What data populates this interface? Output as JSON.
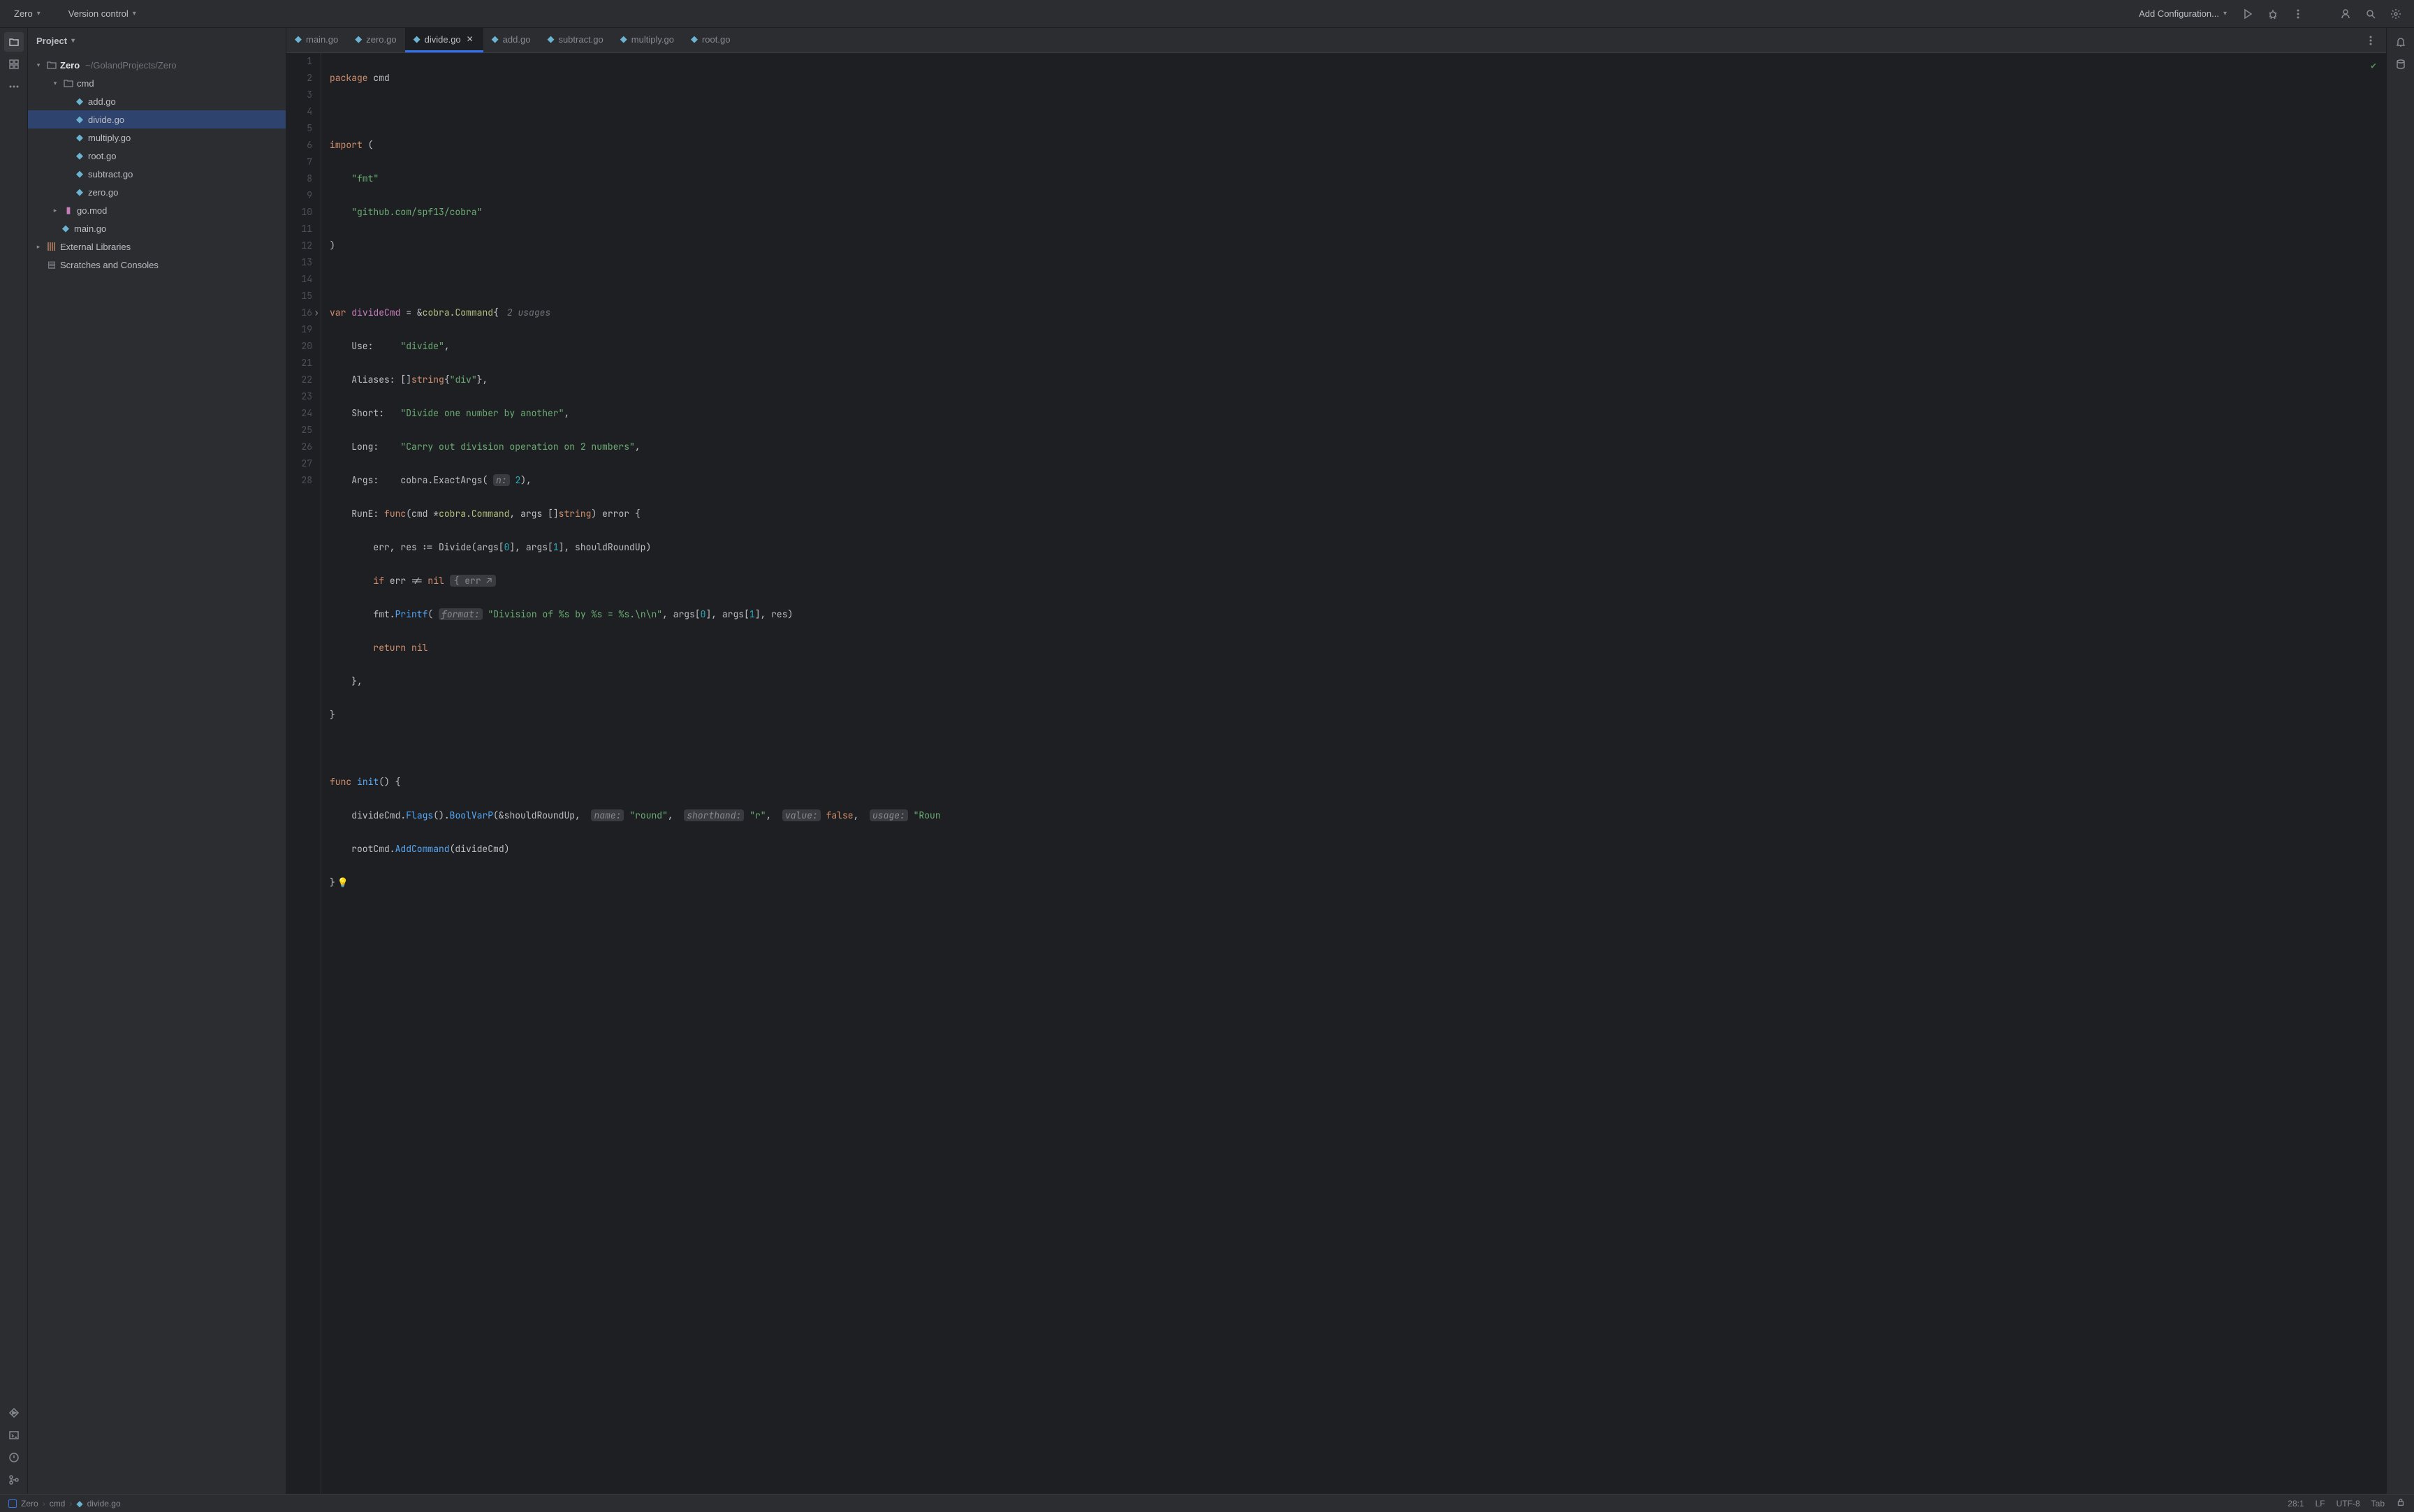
{
  "topbar": {
    "project_name": "Zero",
    "vcs_label": "Version control",
    "run_config": "Add Configuration..."
  },
  "project": {
    "title": "Project",
    "root_name": "Zero",
    "root_path": "~/GolandProjects/Zero",
    "cmd_folder": "cmd",
    "files": {
      "add": "add.go",
      "divide": "divide.go",
      "multiply": "multiply.go",
      "root": "root.go",
      "subtract": "subtract.go",
      "zero": "zero.go"
    },
    "gomod": "go.mod",
    "main": "main.go",
    "external": "External Libraries",
    "scratches": "Scratches and Consoles"
  },
  "tabs": [
    {
      "label": "main.go",
      "active": false
    },
    {
      "label": "zero.go",
      "active": false
    },
    {
      "label": "divide.go",
      "active": true
    },
    {
      "label": "add.go",
      "active": false
    },
    {
      "label": "subtract.go",
      "active": false
    },
    {
      "label": "multiply.go",
      "active": false
    },
    {
      "label": "root.go",
      "active": false
    }
  ],
  "code": {
    "lines": 28,
    "l1_pkg": "package",
    "l1_name": "cmd",
    "l3_import": "import",
    "l4_fmt": "\"fmt\"",
    "l5_cobra": "\"github.com/spf13/cobra\"",
    "l8_var": "var",
    "l8_name": "divideCmd",
    "l8_eq": "= &",
    "l8_type": "cobra.Command",
    "l8_usage": "2 usages",
    "l9_k": "Use:",
    "l9_v": "\"divide\"",
    "l10_k": "Aliases:",
    "l10_t": "string",
    "l10_v": "\"div\"",
    "l11_k": "Short:",
    "l11_v": "\"Divide one number by another\"",
    "l12_k": "Long:",
    "l12_v": "\"Carry out division operation on 2 numbers\"",
    "l13_k": "Args:",
    "l13_fn": "cobra.ExactArgs",
    "l13_hint": "n:",
    "l13_n": "2",
    "l14_k": "RunE:",
    "l14_func": "func",
    "l14_cmd": "cmd *",
    "l14_cmdt": "cobra.Command",
    "l14_args": ", args []",
    "l14_str": "string",
    "l14_err": ") error {",
    "l15": "err, res := Divide(args[",
    "l15_0": "0",
    "l15_m": "], args[",
    "l15_1": "1",
    "l15_e": "], shouldRoundUp)",
    "l16_if": "if",
    "l16_c": " err != ",
    "l16_nil": "nil",
    "l16_fold": "{ err ↗",
    "l19_fmt": "fmt.",
    "l19_printf": "Printf",
    "l19_hint": "format:",
    "l19_str": "\"Division of %s by %s = %s.\\n\\n\"",
    "l19_a0": ", args[",
    "l19_0": "0",
    "l19_a1": "], args[",
    "l19_1": "1",
    "l19_r": "], res)",
    "l20_ret": "return",
    "l20_nil": "nil",
    "l24_func": "func",
    "l24_init": "init",
    "l25_a": "divideCmd.",
    "l25_flags": "Flags",
    "l25_b": "().",
    "l25_bvp": "BoolVarP",
    "l25_c": "(&shouldRoundUp, ",
    "l25_h1": "name:",
    "l25_v1": "\"round\"",
    "l25_h2": "shorthand:",
    "l25_v2": "\"r\"",
    "l25_h3": "value:",
    "l25_v3": "false",
    "l25_h4": "usage:",
    "l25_v4": "\"Roun",
    "l26_a": "rootCmd.",
    "l26_add": "AddCommand",
    "l26_b": "(divideCmd)"
  },
  "status": {
    "breadcrumb": [
      "Zero",
      "cmd",
      "divide.go"
    ],
    "position": "28:1",
    "line_sep": "LF",
    "encoding": "UTF-8",
    "indent": "Tab"
  }
}
